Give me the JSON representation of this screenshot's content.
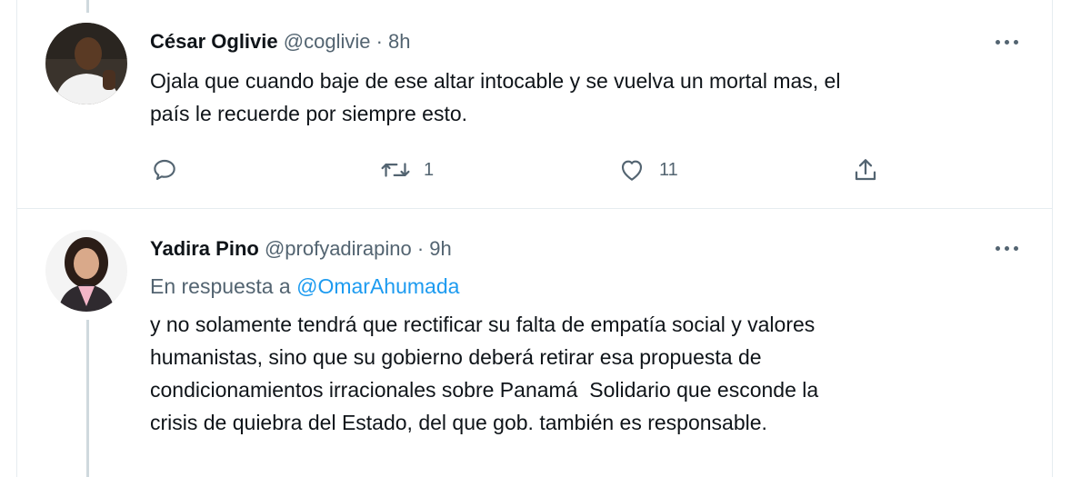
{
  "tweets": [
    {
      "name": "César Oglivie",
      "handle": "@coglivie",
      "separator": "·",
      "time": "8h",
      "text_lines": [
        "Ojala que cuando baje de ese altar intocable y se vuelva un mortal mas, el",
        "país le recuerde por siempre esto."
      ],
      "actions": {
        "reply_icon": "reply-icon",
        "retweet_icon": "retweet-icon",
        "retweet_count": "1",
        "like_icon": "heart-icon",
        "like_count": "11",
        "share_icon": "share-icon"
      }
    },
    {
      "name": "Yadira Pino",
      "handle": "@profyadirapino",
      "separator": "·",
      "time": "9h",
      "reply_prefix": "En respuesta a",
      "reply_mention": "@OmarAhumada",
      "text_lines": [
        "y no solamente tendrá que rectificar su falta de empatía social y valores",
        "humanistas, sino que su gobierno deberá retirar esa propuesta de",
        "condicionamientos irracionales sobre Panamá  Solidario que esconde la",
        "crisis de quiebra del Estado, del que gob. también es responsable."
      ]
    }
  ],
  "colors": {
    "text": "#0f1419",
    "secondary": "#536471",
    "link": "#1d9bf0",
    "border": "#e6ecf0"
  }
}
